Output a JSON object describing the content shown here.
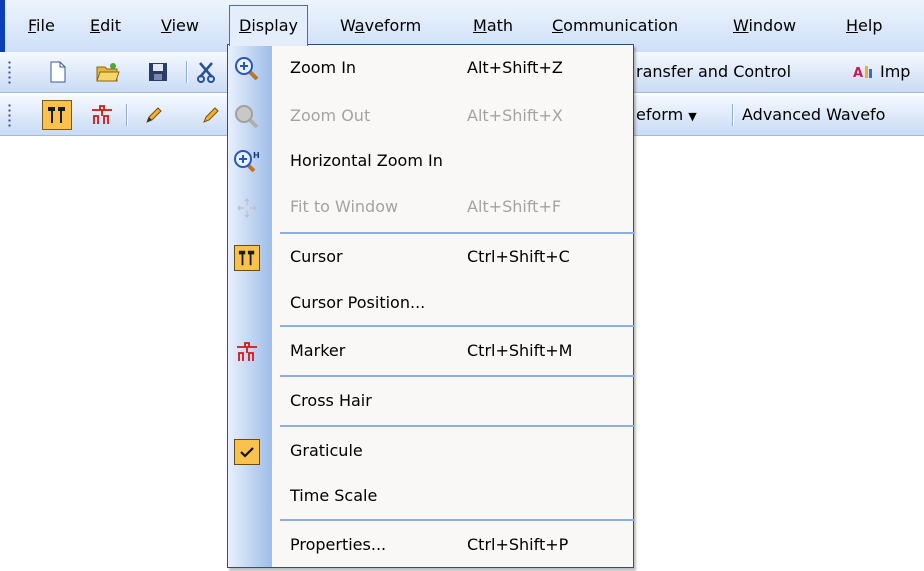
{
  "menubar": {
    "items": [
      "File",
      "Edit",
      "View",
      "Display",
      "Waveform",
      "Math",
      "Communication",
      "Window",
      "Help"
    ],
    "mnemonics": [
      "F",
      "E",
      "V",
      "D",
      "a",
      "M",
      "C",
      "W",
      "H"
    ],
    "active": "Display"
  },
  "toolbar1": {
    "buttons": [
      "new-file-icon",
      "open-folder-icon",
      "save-icon",
      "cut-icon"
    ],
    "text_transfer": "ransfer and Control",
    "text_import": "Imp"
  },
  "toolbar2": {
    "buttons": [
      "cursor-icon",
      "marker-icon",
      "pencil-icon",
      "pencil-icon"
    ],
    "text_waveform": "eform",
    "text_advanced": "Advanced Wavefo"
  },
  "display_menu": {
    "items": [
      {
        "label": "Zoom In",
        "shortcut": "Alt+Shift+Z",
        "enabled": true,
        "icon": "zoom-in-icon"
      },
      {
        "label": "Zoom Out",
        "shortcut": "Alt+Shift+X",
        "enabled": false,
        "icon": "zoom-out-icon"
      },
      {
        "label": "Horizontal Zoom In",
        "shortcut": "",
        "enabled": true,
        "icon": "horizontal-zoom-in-icon"
      },
      {
        "label": "Fit to Window",
        "shortcut": "Alt+Shift+F",
        "enabled": false,
        "icon": "fit-to-window-icon"
      },
      {
        "label": "Cursor",
        "shortcut": "Ctrl+Shift+C",
        "enabled": true,
        "icon": "cursor-icon"
      },
      {
        "label": "Cursor Position...",
        "shortcut": "",
        "enabled": true,
        "icon": ""
      },
      {
        "label": "Marker",
        "shortcut": "Ctrl+Shift+M",
        "enabled": true,
        "icon": "marker-icon"
      },
      {
        "label": "Cross Hair",
        "shortcut": "",
        "enabled": true,
        "icon": ""
      },
      {
        "label": "Graticule",
        "shortcut": "",
        "enabled": true,
        "checked": true,
        "icon": "checkmark-icon"
      },
      {
        "label": "Time Scale",
        "shortcut": "",
        "enabled": true,
        "icon": ""
      },
      {
        "label": "Properties...",
        "shortcut": "Ctrl+Shift+P",
        "enabled": true,
        "icon": ""
      }
    ]
  },
  "colors": {
    "accent": "#2d4f86",
    "check_bg": "#f9c24d",
    "disabled_text": "#a3a3a3"
  }
}
